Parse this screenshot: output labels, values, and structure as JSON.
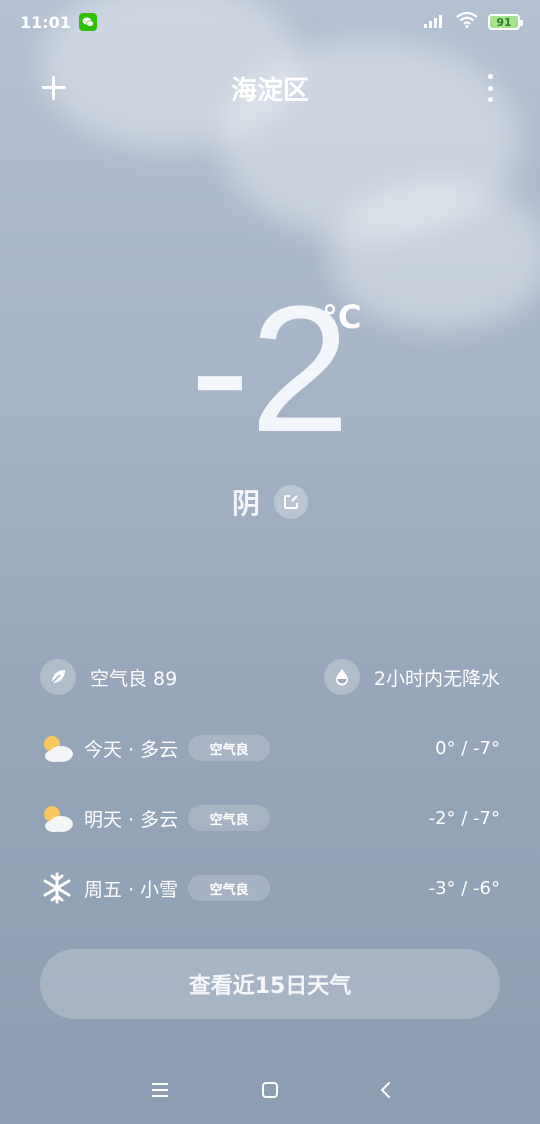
{
  "status_bar": {
    "time": "11:01",
    "battery": "91"
  },
  "header": {
    "city": "海淀区"
  },
  "current": {
    "temperature": "-2",
    "unit": "°C",
    "condition": "阴"
  },
  "info": {
    "air_quality": "空气良 89",
    "precipitation": "2小时内无降水"
  },
  "forecast": [
    {
      "label": "今天 · 多云",
      "aqi": "空气良",
      "range": "0° / -7°",
      "icon": "partly-cloudy-icon"
    },
    {
      "label": "明天 · 多云",
      "aqi": "空气良",
      "range": "-2° / -7°",
      "icon": "partly-cloudy-icon"
    },
    {
      "label": "周五 · 小雪",
      "aqi": "空气良",
      "range": "-3° / -6°",
      "icon": "snowflake-icon"
    }
  ],
  "cta": {
    "label": "查看近15日天气"
  }
}
